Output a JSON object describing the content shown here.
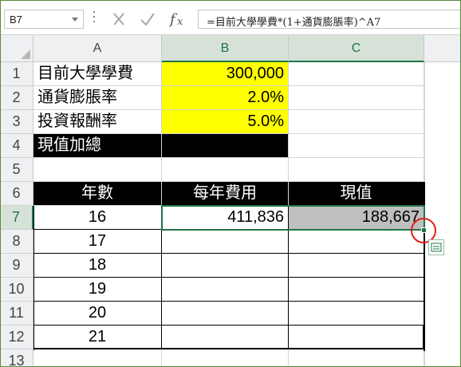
{
  "formula_bar": {
    "name_box": "B7",
    "formula": "=目前大學學費*(1+通貨膨脹率)^A7",
    "icons": [
      "cancel-icon",
      "enter-checkmark-icon",
      "insert-function-icon"
    ]
  },
  "columns": [
    "A",
    "B",
    "C"
  ],
  "rows": [
    "1",
    "2",
    "3",
    "4",
    "5",
    "6",
    "7",
    "8",
    "9",
    "10",
    "11",
    "12",
    "13"
  ],
  "cells": {
    "a1": "目前大學學費",
    "b1": "300,000",
    "a2": "通貨膨脹率",
    "b2": "2.0%",
    "a3": "投資報酬率",
    "b3": "5.0%",
    "a4": "現值加總",
    "a6": "年數",
    "b6": "每年費用",
    "c6": "現值",
    "a7": "16",
    "b7": "411,836",
    "c7": "188,667",
    "a8": "17",
    "a9": "18",
    "a10": "19",
    "a11": "20",
    "a12": "21"
  },
  "selection": {
    "active_cell": "B7",
    "range": "B7:C7"
  },
  "colors": {
    "accent": "#217346",
    "yellow_fill": "#ffff00",
    "header_fill": "#000000",
    "gray_fill": "#bfbfbf",
    "highlight_circle": "#e01e1e"
  }
}
